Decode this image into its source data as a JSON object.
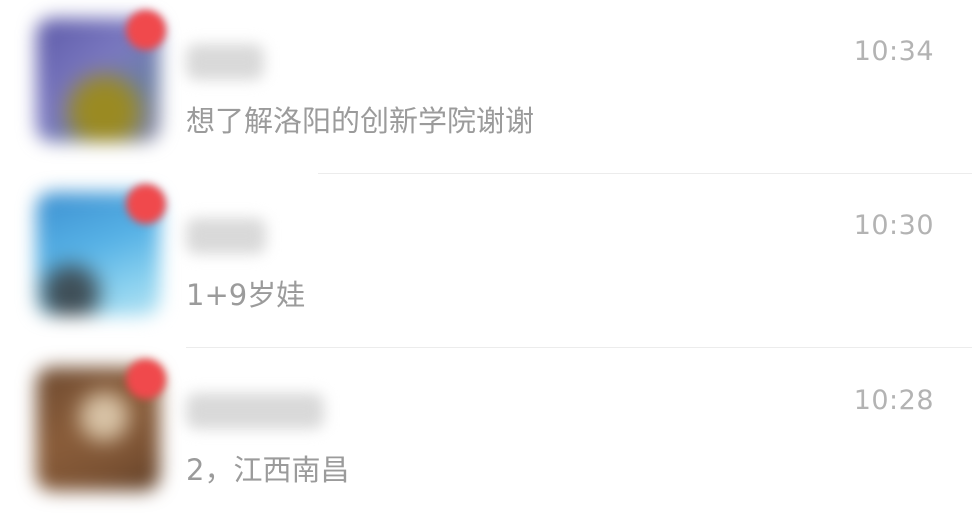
{
  "conversations": [
    {
      "avatar": "blurred-profile-photo",
      "time": "10:34",
      "preview": "想了解洛阳的创新学院谢谢",
      "unread": true
    },
    {
      "avatar": "blurred-profile-photo",
      "time": "10:30",
      "preview": "1+9岁娃",
      "unread": true
    },
    {
      "avatar": "blurred-profile-photo",
      "time": "10:28",
      "preview": "2，江西南昌",
      "unread": true
    }
  ],
  "colors": {
    "background": "#ffffff",
    "unread_badge": "#f0494c",
    "time_text": "#b3b3b3",
    "preview_text": "#9b9b9b",
    "divider": "#ececec"
  }
}
